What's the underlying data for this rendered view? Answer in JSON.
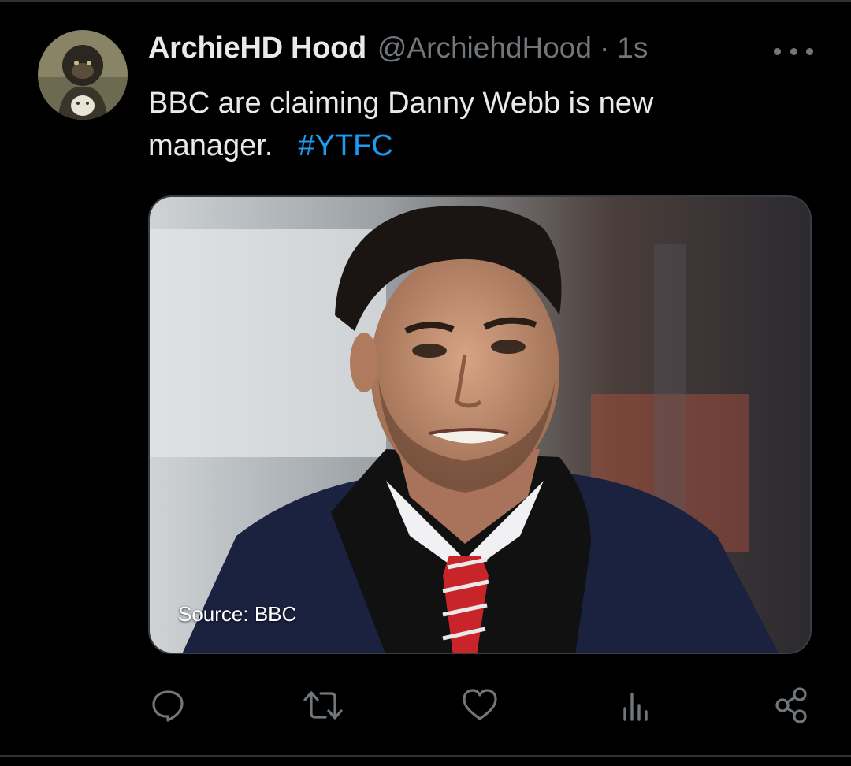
{
  "tweet": {
    "display_name": "ArchieHD Hood",
    "handle": "@ArchiehdHood",
    "separator": "·",
    "timestamp": "1s",
    "text": "BBC are claiming Danny Webb is new manager.",
    "hashtag": "#YTFC",
    "media_caption": "Source: BBC"
  },
  "actions": [
    {
      "name": "reply",
      "icon": "speech-bubble-icon"
    },
    {
      "name": "retweet",
      "icon": "retweet-arrows-icon"
    },
    {
      "name": "like",
      "icon": "heart-icon"
    },
    {
      "name": "views",
      "icon": "bar-chart-icon"
    },
    {
      "name": "share",
      "icon": "share-nodes-icon"
    }
  ],
  "colors": {
    "background": "#000000",
    "text_primary": "#e7e9ea",
    "text_secondary": "#71767b",
    "link": "#1d9bf0",
    "divider": "#2f3336"
  }
}
